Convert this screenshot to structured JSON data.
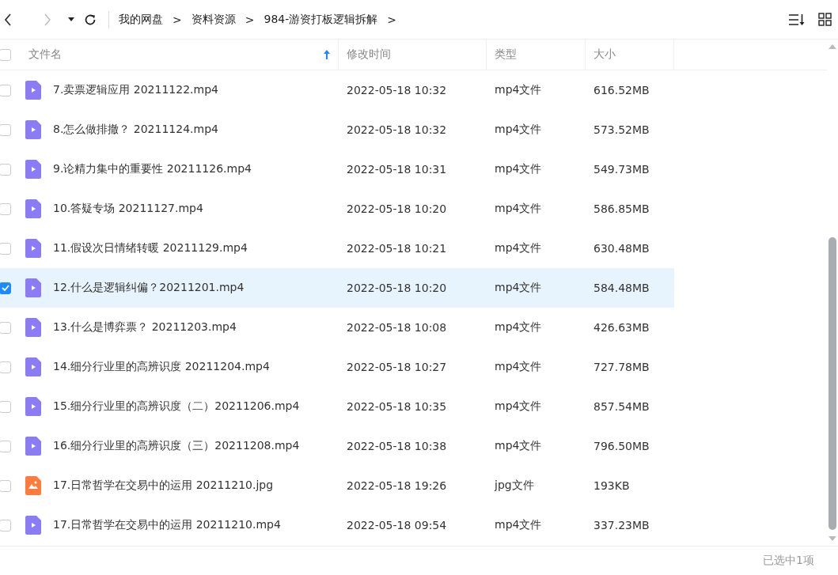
{
  "toolbar": {
    "breadcrumb": [
      "我的网盘",
      "资料资源",
      "984-游资打板逻辑拆解"
    ],
    "separator": ">"
  },
  "table": {
    "select_all": {
      "checked": false
    },
    "columns": [
      "文件名",
      "修改时间",
      "类型",
      "大小"
    ],
    "rows": [
      {
        "name": "7.卖票逻辑应用 20211122.mp4",
        "modified": "2022-05-18 10:32",
        "type": "mp4文件",
        "size": "616.52MB",
        "kind": "video",
        "selected": false
      },
      {
        "name": "8.怎么做排撤？  20211124.mp4",
        "modified": "2022-05-18 10:32",
        "type": "mp4文件",
        "size": "573.52MB",
        "kind": "video",
        "selected": false
      },
      {
        "name": "9.论精力集中的重要性  20211126.mp4",
        "modified": "2022-05-18 10:31",
        "type": "mp4文件",
        "size": "549.73MB",
        "kind": "video",
        "selected": false
      },
      {
        "name": "10.答疑专场 20211127.mp4",
        "modified": "2022-05-18 10:20",
        "type": "mp4文件",
        "size": "586.85MB",
        "kind": "video",
        "selected": false
      },
      {
        "name": "11.假设次日情绪转暖 20211129.mp4",
        "modified": "2022-05-18 10:21",
        "type": "mp4文件",
        "size": "630.48MB",
        "kind": "video",
        "selected": false
      },
      {
        "name": "12.什么是逻辑纠偏？20211201.mp4",
        "modified": "2022-05-18 10:20",
        "type": "mp4文件",
        "size": "584.48MB",
        "kind": "video",
        "selected": true
      },
      {
        "name": "13.什么是博弈票？  20211203.mp4",
        "modified": "2022-05-18 10:08",
        "type": "mp4文件",
        "size": "426.63MB",
        "kind": "video",
        "selected": false
      },
      {
        "name": "14.细分行业里的高辨识度 20211204.mp4",
        "modified": "2022-05-18 10:27",
        "type": "mp4文件",
        "size": "727.78MB",
        "kind": "video",
        "selected": false
      },
      {
        "name": "15.细分行业里的高辨识度（二）20211206.mp4",
        "modified": "2022-05-18 10:35",
        "type": "mp4文件",
        "size": "857.54MB",
        "kind": "video",
        "selected": false
      },
      {
        "name": "16.细分行业里的高辨识度（三）20211208.mp4",
        "modified": "2022-05-18 10:38",
        "type": "mp4文件",
        "size": "796.50MB",
        "kind": "video",
        "selected": false
      },
      {
        "name": "17.日常哲学在交易中的运用  20211210.jpg",
        "modified": "2022-05-18 19:26",
        "type": "jpg文件",
        "size": "193KB",
        "kind": "image",
        "selected": false
      },
      {
        "name": "17.日常哲学在交易中的运用  20211210.mp4",
        "modified": "2022-05-18 09:54",
        "type": "mp4文件",
        "size": "337.23MB",
        "kind": "video",
        "selected": false
      }
    ]
  },
  "status_bar": "已选中1项"
}
